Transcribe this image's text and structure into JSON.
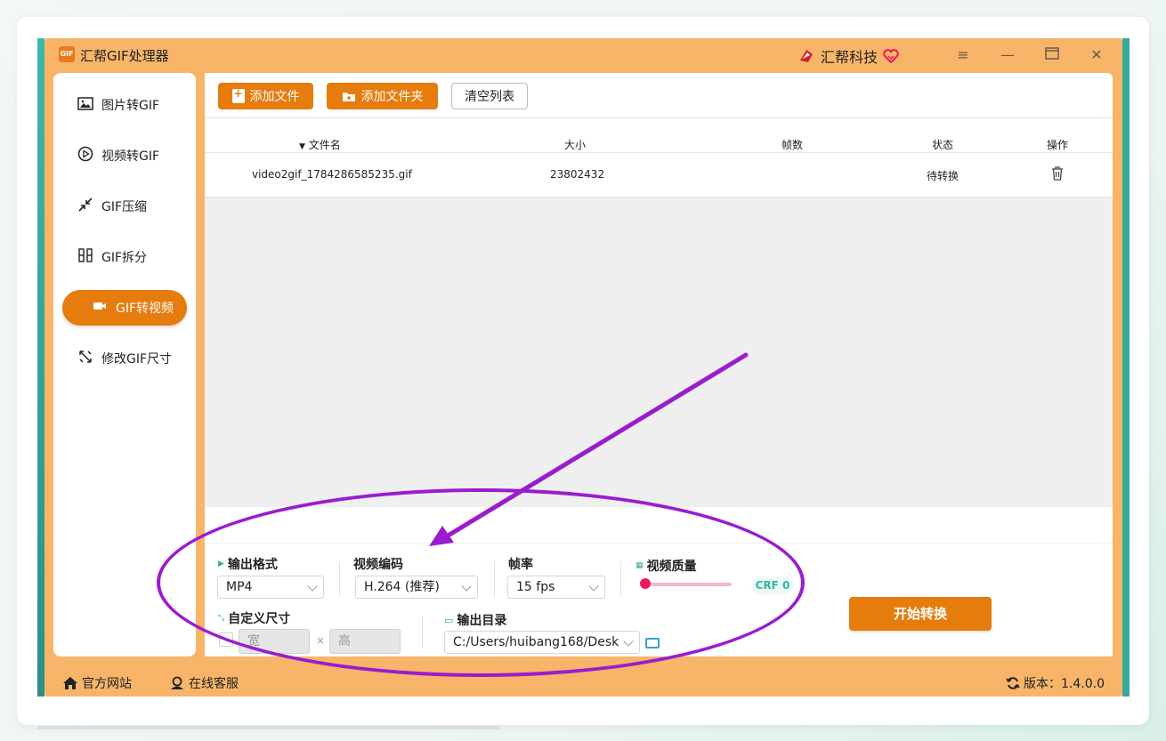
{
  "app": {
    "title": "汇帮GIF处理器",
    "logo_text": "GIF",
    "brand": "汇帮科技",
    "accent": "#e57c0d",
    "frame_color": "#f8b56a"
  },
  "window_controls": [
    "menu-icon",
    "minimize-icon",
    "maximize-icon",
    "close-icon"
  ],
  "sidebar": {
    "items": [
      {
        "label": "图片转GIF",
        "icon": "image-icon",
        "active": false
      },
      {
        "label": "视频转GIF",
        "icon": "play-circle-icon",
        "active": false
      },
      {
        "label": "GIF压缩",
        "icon": "compress-icon",
        "active": false
      },
      {
        "label": "GIF拆分",
        "icon": "split-icon",
        "active": false
      },
      {
        "label": "GIF转视频",
        "icon": "video-icon",
        "active": true
      },
      {
        "label": "修改GIF尺寸",
        "icon": "resize-icon",
        "active": false
      }
    ]
  },
  "toolbar": {
    "add_file": "添加文件",
    "add_folder": "添加文件夹",
    "clear_list": "清空列表"
  },
  "table": {
    "headers": {
      "name": "文件名",
      "size": "大小",
      "frames": "帧数",
      "status": "状态",
      "action": "操作"
    },
    "rows": [
      {
        "name": "video2gif_1784286585235.gif",
        "size": "23802432",
        "frames": "",
        "status": "待转换",
        "action_icon": "trash-icon"
      }
    ]
  },
  "settings": {
    "output_format_label": "输出格式",
    "output_format_value": "MP4",
    "codec_label": "视频编码",
    "codec_value": "H.264 (推荐)",
    "fps_label": "帧率",
    "fps_value": "15 fps",
    "quality_label": "视频质量",
    "quality_value": "CRF 0",
    "quality_level": 0,
    "custom_size_label": "自定义尺寸",
    "width_placeholder": "宽",
    "height_placeholder": "高",
    "times_sign": "×",
    "output_dir_label": "输出目录",
    "output_dir_value": "C:/Users/huibang168/Desk",
    "start_button": "开始转换"
  },
  "footer": {
    "website": "官方网站",
    "support": "在线客服",
    "version": "版本：1.4.0.0"
  },
  "annotation_color": "#9a1ccf"
}
